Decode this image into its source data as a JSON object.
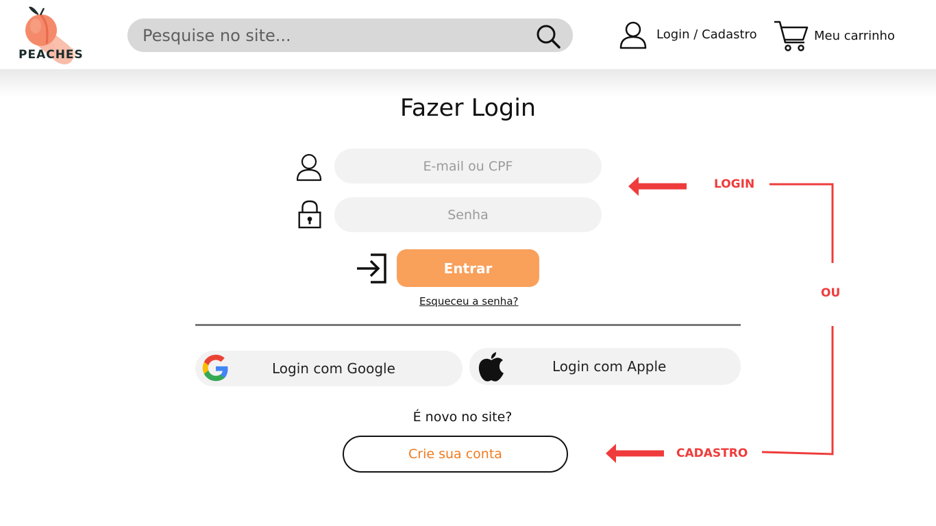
{
  "brand": {
    "name": "PEACHES",
    "colors": {
      "peach": "#f48a6a",
      "peach_dark": "#e86a4c",
      "leaf": "#1e2b2b"
    }
  },
  "header": {
    "search": {
      "placeholder": "Pesquise no site...",
      "icon": "search-icon"
    },
    "login_label": "Login / Cadastro",
    "cart_label": "Meu carrinho"
  },
  "main": {
    "title": "Fazer Login",
    "email": {
      "placeholder": "E-mail ou CPF",
      "icon": "user-icon"
    },
    "password": {
      "placeholder": "Senha",
      "icon": "lock-icon"
    },
    "enter_label": "Entrar",
    "forgot_label": "Esqueceu a senha?",
    "google_label": "Login com Google",
    "apple_label": "Login com Apple",
    "new_question": "É novo no site?",
    "create_label": "Crie sua conta"
  },
  "annotations": {
    "login": "LOGIN",
    "or": "OU",
    "signup": "CADASTRO",
    "color": "#ef3b3b"
  },
  "colors": {
    "accent": "#f9a05b",
    "create_text": "#f07b20",
    "field_bg": "#f2f2f2",
    "search_bg": "#d8d8d8"
  }
}
